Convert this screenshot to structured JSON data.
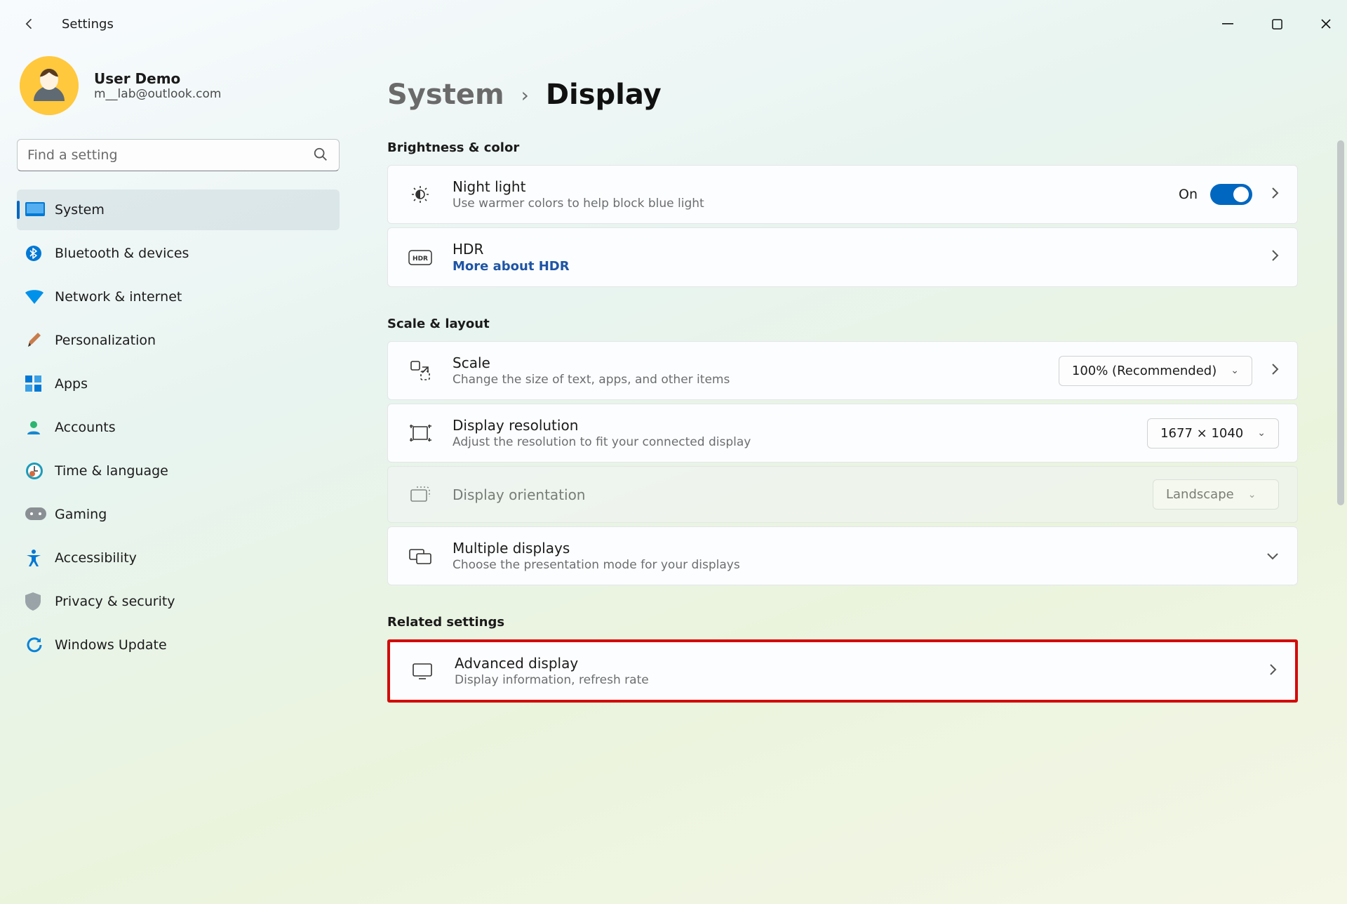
{
  "app_title": "Settings",
  "user": {
    "name": "User Demo",
    "email": "m__lab@outlook.com"
  },
  "search": {
    "placeholder": "Find a setting"
  },
  "nav": [
    {
      "key": "system",
      "label": "System",
      "selected": true
    },
    {
      "key": "bluetooth",
      "label": "Bluetooth & devices",
      "selected": false
    },
    {
      "key": "network",
      "label": "Network & internet",
      "selected": false
    },
    {
      "key": "personalize",
      "label": "Personalization",
      "selected": false
    },
    {
      "key": "apps",
      "label": "Apps",
      "selected": false
    },
    {
      "key": "accounts",
      "label": "Accounts",
      "selected": false
    },
    {
      "key": "time",
      "label": "Time & language",
      "selected": false
    },
    {
      "key": "gaming",
      "label": "Gaming",
      "selected": false
    },
    {
      "key": "accessibility",
      "label": "Accessibility",
      "selected": false
    },
    {
      "key": "privacy",
      "label": "Privacy & security",
      "selected": false
    },
    {
      "key": "update",
      "label": "Windows Update",
      "selected": false
    }
  ],
  "crumb": {
    "root": "System",
    "leaf": "Display"
  },
  "sections": {
    "brightness": {
      "heading": "Brightness & color",
      "night": {
        "title": "Night light",
        "sub": "Use warmer colors to help block blue light",
        "state_label": "On"
      },
      "hdr": {
        "title": "HDR",
        "link": "More about HDR"
      }
    },
    "scale": {
      "heading": "Scale & layout",
      "scale_card": {
        "title": "Scale",
        "sub": "Change the size of text, apps, and other items",
        "value": "100% (Recommended)"
      },
      "resolution": {
        "title": "Display resolution",
        "sub": "Adjust the resolution to fit your connected display",
        "value": "1677 × 1040"
      },
      "orientation": {
        "title": "Display orientation",
        "value": "Landscape"
      },
      "multi": {
        "title": "Multiple displays",
        "sub": "Choose the presentation mode for your displays"
      }
    },
    "related": {
      "heading": "Related settings",
      "advanced": {
        "title": "Advanced display",
        "sub": "Display information, refresh rate"
      }
    }
  }
}
